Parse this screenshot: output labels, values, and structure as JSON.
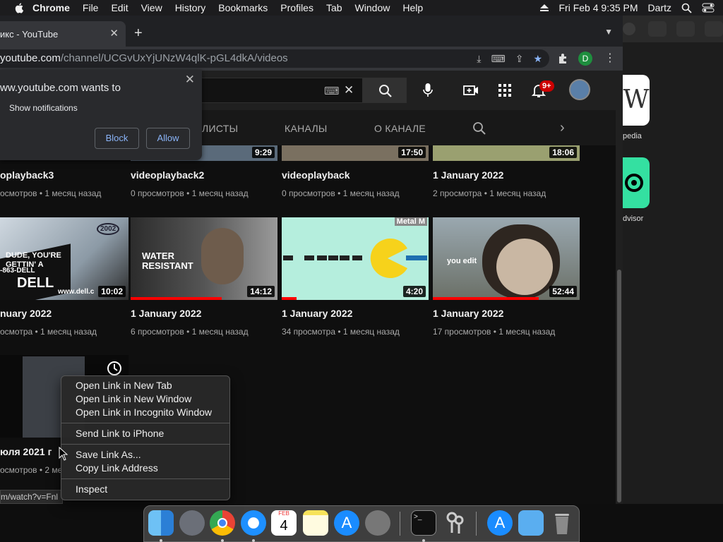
{
  "menubar": {
    "items": [
      "Chrome",
      "File",
      "Edit",
      "View",
      "History",
      "Bookmarks",
      "Profiles",
      "Tab",
      "Window",
      "Help"
    ],
    "datetime": "Fri Feb 4  9:35 PM",
    "user": "Dartz"
  },
  "tab": {
    "title": "икс - YouTube"
  },
  "address": {
    "host": "youtube.com",
    "path": "/channel/UCGvUxYjUNzW4qlK-pGL4dkA/videos"
  },
  "profile_initial": "D",
  "notification_popup": {
    "title": "ww.youtube.com wants to",
    "subtitle": "Show notifications",
    "block_label": "Block",
    "allow_label": "Allow"
  },
  "yt": {
    "bell_badge": "9+",
    "channel_tabs": [
      "ЛИСТЫ",
      "КАНАЛЫ",
      "О КАНАЛЕ"
    ]
  },
  "row1": [
    {
      "title": "oplayback3",
      "meta": "осмотров • 1 месяц назад",
      "duration": ""
    },
    {
      "title": "videoplayback2",
      "meta": "0 просмотров • 1 месяц назад",
      "duration": "9:29"
    },
    {
      "title": "videoplayback",
      "meta": "0 просмотров • 1 месяц назад",
      "duration": "17:50"
    },
    {
      "title": "1 January 2022",
      "meta": "2 просмотра • 1 месяц назад",
      "duration": "18:06"
    }
  ],
  "row2": [
    {
      "title": "nuary 2022",
      "meta": "осмотра • 1 месяц назад",
      "duration": "10:02",
      "progress": 0
    },
    {
      "title": "1 January 2022",
      "meta": "6 просмотров • 1 месяц назад",
      "duration": "14:12",
      "progress": 0.62
    },
    {
      "title": "1 January 2022",
      "meta": "34 просмотра • 1 месяц назад",
      "duration": "4:20",
      "progress": 0.1
    },
    {
      "title": "1 January 2022",
      "meta": "17 просмотров • 1 месяц назад",
      "duration": "52:44",
      "progress": 0.72
    }
  ],
  "row3": {
    "title": "юля 2021 г",
    "meta": "осмотров • 2 ме"
  },
  "thumb_text": {
    "dude": "DUDE, YOU'RE GETTIN' A",
    "dell": "DELL",
    "dell_url": "www.dell.c",
    "dell_phone": "-863-DELL",
    "dell_year": "2002",
    "water": "WATER RESISTANT",
    "pac_brand": "Metal M",
    "you_edit": "you edit"
  },
  "status_link": "m/watch?v=Fnl",
  "context_menu": {
    "open_new_tab": "Open Link in New Tab",
    "open_new_window": "Open Link in New Window",
    "open_incognito": "Open Link in Incognito Window",
    "send_iphone": "Send Link to iPhone",
    "save_as": "Save Link As...",
    "copy_address": "Copy Link Address",
    "inspect": "Inspect"
  },
  "bg_window": {
    "label1": "pedia",
    "label2": "dvisor",
    "wiki_letter": "W"
  },
  "dock": {
    "calendar_month": "FEB",
    "calendar_day": "4"
  },
  "colors": {
    "yt_red": "#ff0000",
    "chrome_toolbar": "#35363a",
    "link_blue": "#8ab4f8"
  }
}
